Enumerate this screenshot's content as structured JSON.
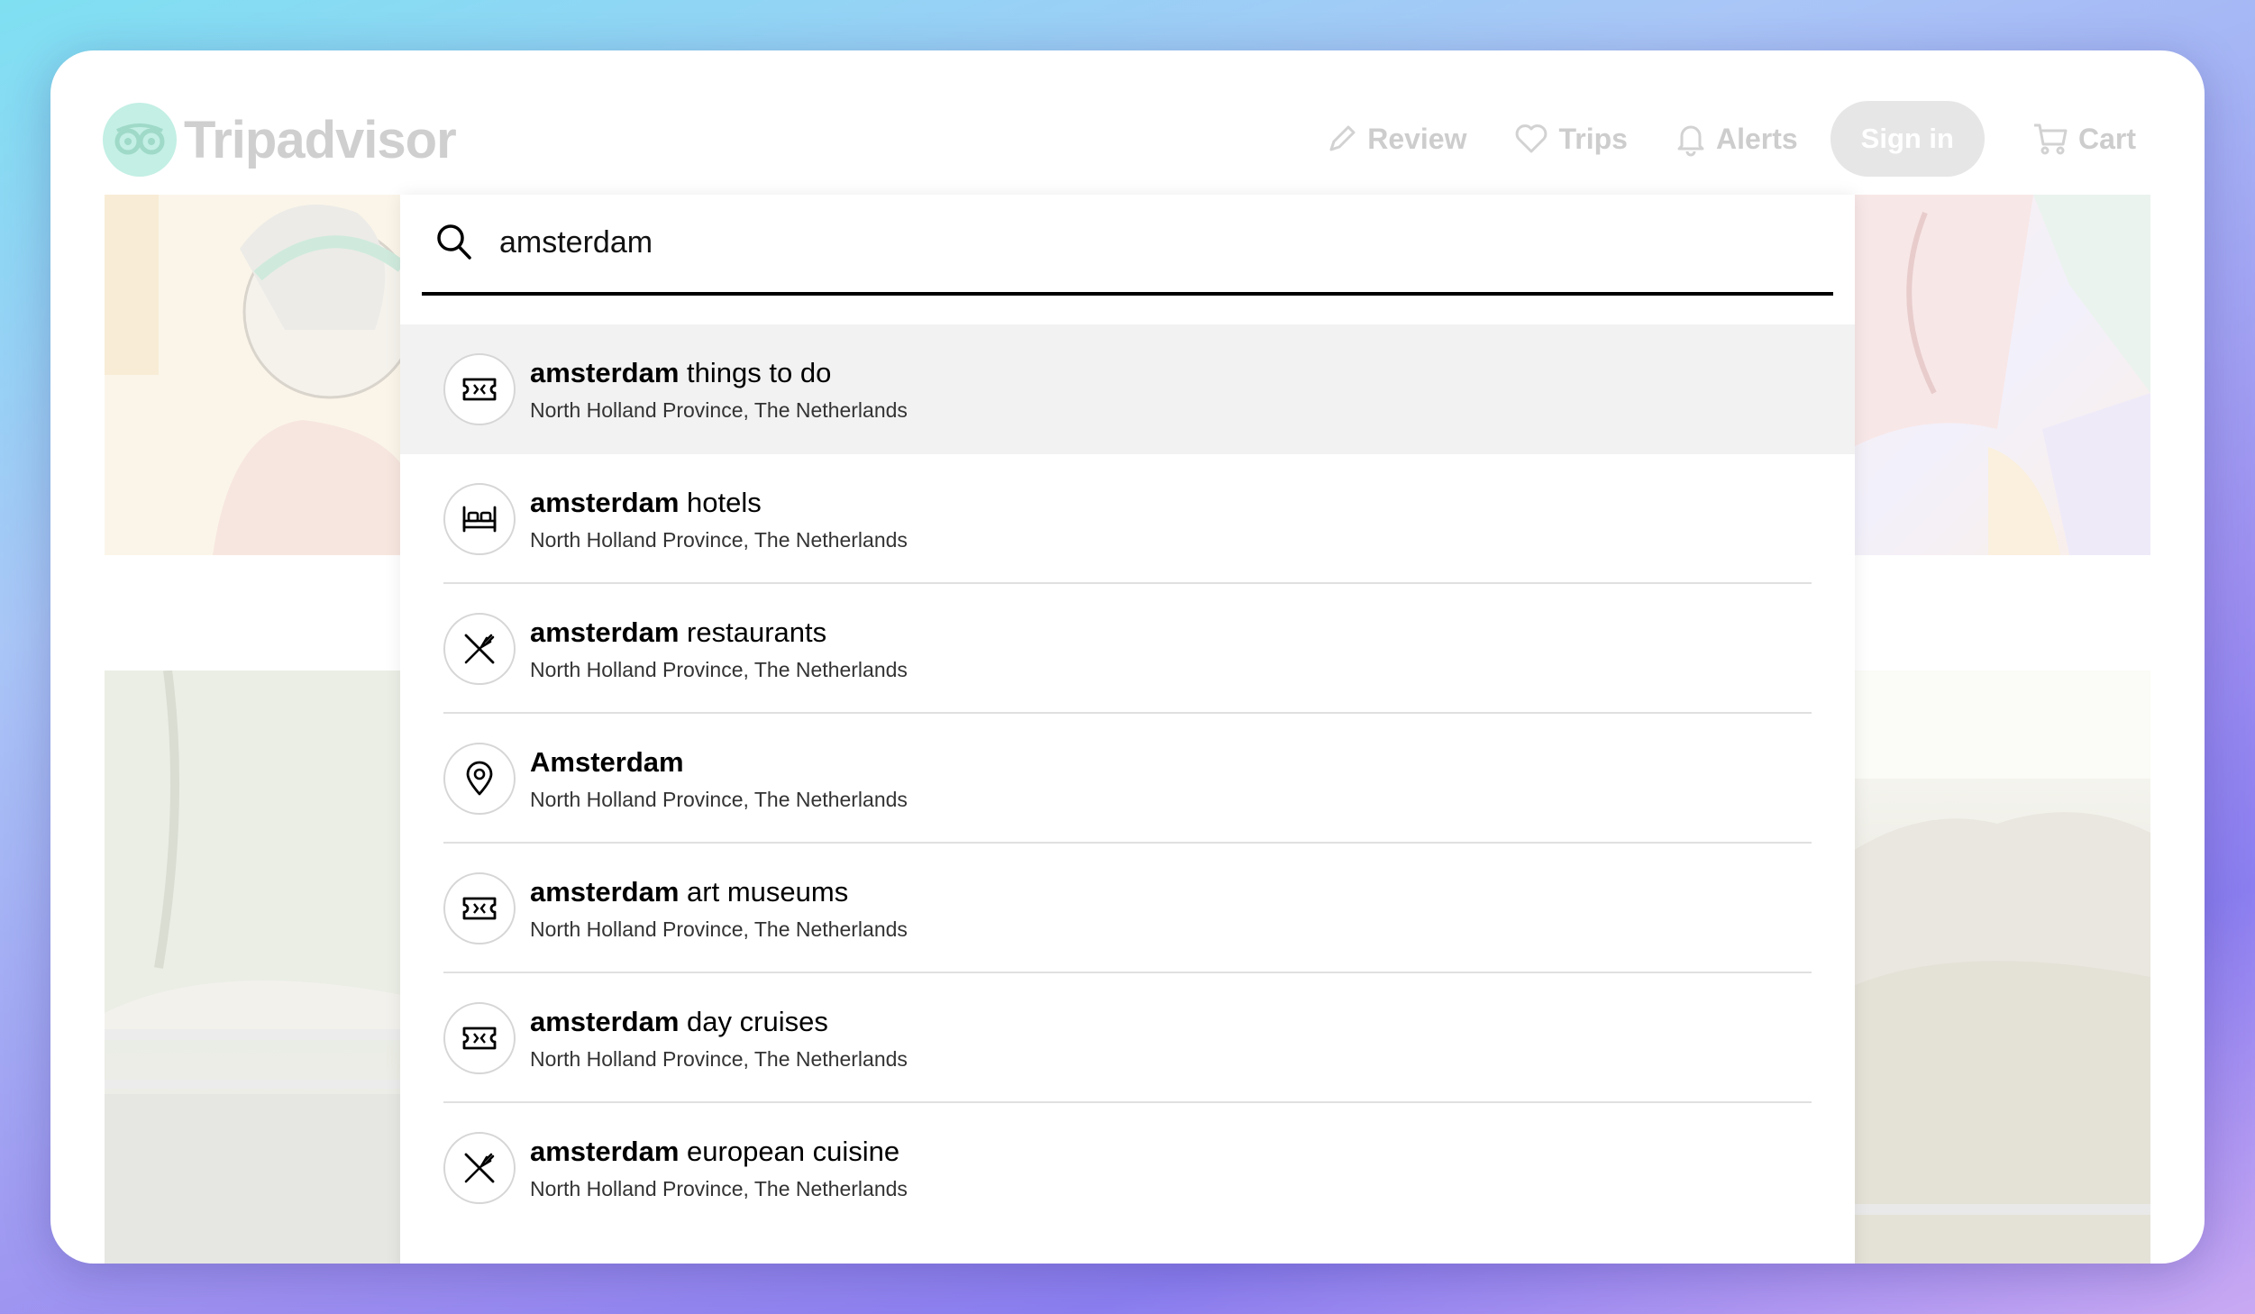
{
  "header": {
    "logo_text": "Tripadvisor",
    "nav": {
      "review": "Review",
      "trips": "Trips",
      "alerts": "Alerts",
      "sign_in": "Sign in",
      "cart": "Cart"
    }
  },
  "search": {
    "value": "amsterdam",
    "icon": "search-icon"
  },
  "results": [
    {
      "bold": "amsterdam",
      "rest": " things to do",
      "subtitle": "North Holland Province, The Netherlands",
      "icon": "ticket-icon",
      "highlighted": true
    },
    {
      "bold": "amsterdam",
      "rest": " hotels",
      "subtitle": "North Holland Province, The Netherlands",
      "icon": "bed-icon",
      "highlighted": false
    },
    {
      "bold": "amsterdam",
      "rest": " restaurants",
      "subtitle": "North Holland Province, The Netherlands",
      "icon": "fork-knife-icon",
      "highlighted": false
    },
    {
      "bold": "Amsterdam",
      "rest": "",
      "subtitle": "North Holland Province, The Netherlands",
      "icon": "map-pin-icon",
      "highlighted": false
    },
    {
      "bold": "amsterdam",
      "rest": " art museums",
      "subtitle": "North Holland Province, The Netherlands",
      "icon": "ticket-icon",
      "highlighted": false
    },
    {
      "bold": "amsterdam",
      "rest": " day cruises",
      "subtitle": "North Holland Province, The Netherlands",
      "icon": "ticket-icon",
      "highlighted": false
    },
    {
      "bold": "amsterdam",
      "rest": " european cuisine",
      "subtitle": "North Holland Province, The Netherlands",
      "icon": "fork-knife-icon",
      "highlighted": false
    }
  ],
  "colors": {
    "highlight_bg": "#f2f2f2",
    "text": "#000000",
    "faded_nav": "#cdcdcd"
  }
}
